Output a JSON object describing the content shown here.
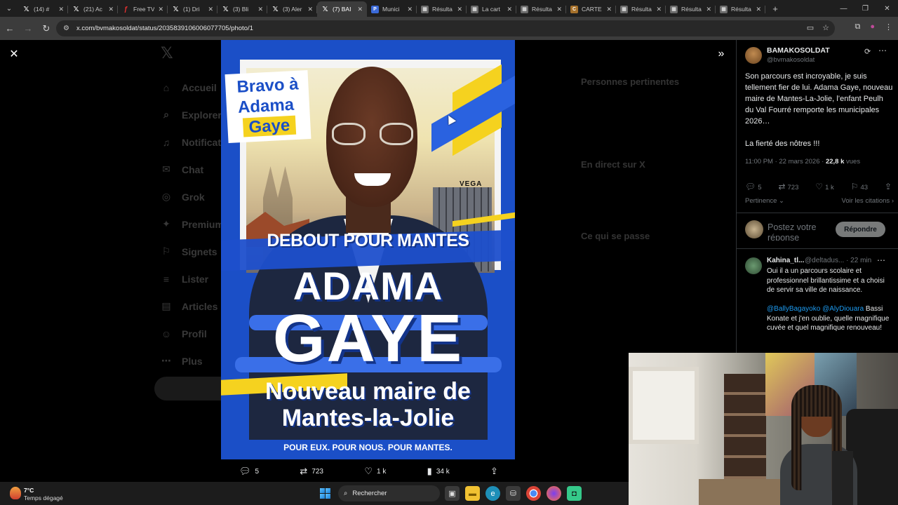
{
  "browser": {
    "tabs": [
      {
        "favicon": "x-logo-icon",
        "glyph": "𝕏",
        "title": "(14) #"
      },
      {
        "favicon": "x-logo-icon",
        "glyph": "𝕏",
        "title": "(21) Ac"
      },
      {
        "favicon": "free-tv-icon",
        "glyph": "ƒ",
        "title": "Free TV"
      },
      {
        "favicon": "x-logo-icon",
        "glyph": "𝕏",
        "title": "(1) Dri"
      },
      {
        "favicon": "x-logo-icon",
        "glyph": "𝕏",
        "title": "(3) Bli"
      },
      {
        "favicon": "x-logo-icon",
        "glyph": "𝕏",
        "title": "(3) Aler"
      },
      {
        "favicon": "x-logo-icon",
        "glyph": "𝕏",
        "title": "(7) BAI",
        "active": true
      },
      {
        "favicon": "calendar-icon",
        "glyph": "P",
        "title": "Munici"
      },
      {
        "favicon": "results-icon",
        "glyph": "▦",
        "title": "Résulta"
      },
      {
        "favicon": "results-icon",
        "glyph": "▦",
        "title": "La cart"
      },
      {
        "favicon": "results-icon",
        "glyph": "▦",
        "title": "Résulta"
      },
      {
        "favicon": "carte-icon",
        "glyph": "C",
        "title": "CARTE"
      },
      {
        "favicon": "results-icon",
        "glyph": "▦",
        "title": "Résulta"
      },
      {
        "favicon": "results-icon",
        "glyph": "▦",
        "title": "Résulta"
      },
      {
        "favicon": "results-icon",
        "glyph": "▦",
        "title": "Résulta"
      }
    ],
    "url": "x.com/bvmakosoldat/status/2035839106006077705/photo/1"
  },
  "poster": {
    "bravo_line1": "Bravo à",
    "bravo_line2": "Adama",
    "bravo_line3": "Gaye",
    "vega": "VEGA",
    "headline": "DEBOUT POUR MANTES",
    "first_name": "ADAMA",
    "last_name": "GAYE",
    "subtitle_line1": "Nouveau maire de",
    "subtitle_line2": "Mantes-la-Jolie",
    "slogan": "POUR EUX. POUR NOUS. POUR MANTES."
  },
  "media_actions": {
    "replies": "5",
    "reposts": "723",
    "likes": "1 k",
    "views": "34 k"
  },
  "tweet": {
    "author_name": "BAMAKOSOLDAT",
    "author_handle": "@bvmakosoldat",
    "text": "Son parcours est incroyable, je suis tellement fier de lui. Adama Gaye, nouveau maire de Mantes-La-Jolie, l’enfant Peulh du Val Fourré remporte les municipales 2026…\n\nLa fierté des nôtres !!!",
    "time": "11:00 PM · 22 mars 2026 · ",
    "views_count": "22,8 k",
    "views_label": " vues",
    "stats": {
      "replies": "5",
      "reposts": "723",
      "likes": "1 k",
      "bookmarks": "43"
    },
    "sort_label": "Pertinence",
    "quotes_label": "Voir les citations"
  },
  "reply_composer": {
    "placeholder": "Postez votre réponse",
    "button": "Répondre"
  },
  "reply": {
    "name": "Kahina_tl...",
    "handle": "@deltadus... · 22 min",
    "text1": "Oui il a un parcours scolaire et professionnel brillantissime et a choisi de servir sa ville de naissance.",
    "mention1": "@BallyBagayoko",
    "mention2": "@AlyDiouara",
    "text2": " Bassi Konate et j'en oublie, quelle magnifique cuvée et quel magnifique renouveau!"
  },
  "background_page": {
    "nav": [
      "Accueil",
      "Explorer",
      "Notifications",
      "Chat",
      "Grok",
      "Premium",
      "Signets",
      "Lister",
      "Articles",
      "Profil",
      "Plus"
    ],
    "nav_icons": [
      "home-icon",
      "search-icon",
      "bell-icon",
      "chat-icon",
      "grok-icon",
      "premium-icon",
      "bookmark-icon",
      "list-icon",
      "article-icon",
      "profile-icon",
      "more-icon"
    ],
    "right_headings": [
      "Personnes pertinentes",
      "En direct sur X",
      "Ce qui se passe"
    ]
  },
  "taskbar": {
    "temperature": "7°C",
    "weather": "Temps dégagé",
    "search_placeholder": "Rechercher"
  },
  "colors": {
    "poster_blue": "#1b4fc7",
    "poster_yellow": "#f5d21f",
    "link_blue": "#1d9bf0",
    "muted_text": "#71767b"
  }
}
